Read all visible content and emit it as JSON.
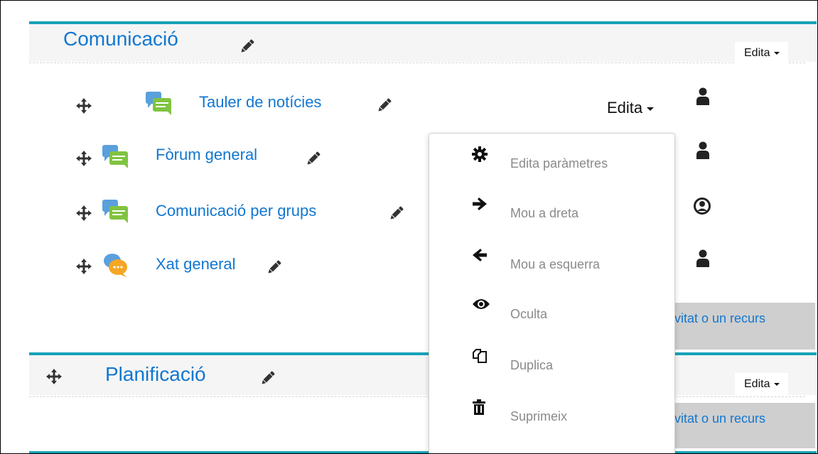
{
  "colors": {
    "link": "#1177d1",
    "accent_bar": "#17a2b8",
    "section_bg": "#f5f5f5",
    "add_button_bg": "#cfcfcf",
    "menu_text": "#8a8a8a"
  },
  "sections": [
    {
      "title": "Comunicació",
      "edit_label": "Edita",
      "add_label": "ivitat o un recurs",
      "activities": [
        {
          "name": "Tauler de notícies",
          "edit_label": "Edita",
          "icon": "forum-icon",
          "group_icon": "user-icon"
        },
        {
          "name": "Fòrum general",
          "icon": "forum-icon",
          "group_icon": "user-icon"
        },
        {
          "name": "Comunicació per grups",
          "icon": "forum-icon",
          "group_icon": "user-circle-icon"
        },
        {
          "name": "Xat general",
          "icon": "chat-icon",
          "group_icon": "user-icon"
        }
      ]
    },
    {
      "title": "Planificació",
      "edit_label": "Edita",
      "add_label": "ivitat o un recurs"
    }
  ],
  "edit_menu": [
    {
      "label": "Edita paràmetres",
      "icon": "gear-icon"
    },
    {
      "label": "Mou a dreta",
      "icon": "arrow-right-icon"
    },
    {
      "label": "Mou a esquerra",
      "icon": "arrow-left-icon"
    },
    {
      "label": "Oculta",
      "icon": "eye-icon"
    },
    {
      "label": "Duplica",
      "icon": "copy-icon"
    },
    {
      "label": "Suprimeix",
      "icon": "trash-icon"
    }
  ]
}
